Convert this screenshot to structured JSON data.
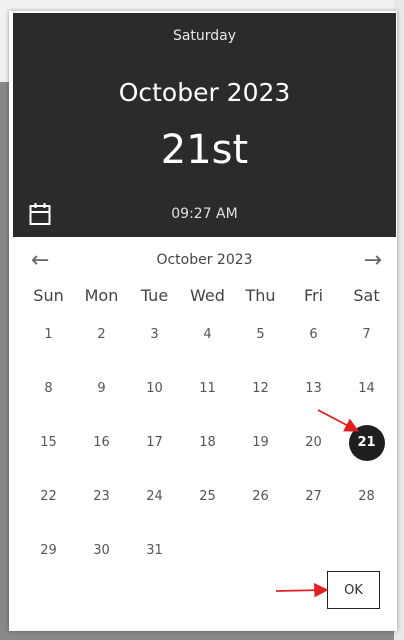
{
  "header": {
    "weekday": "Saturday",
    "month_year": "October 2023",
    "day": "21st",
    "time": "09:27 AM"
  },
  "calendar": {
    "nav_title": "October 2023",
    "prev_icon": "arrow-left-icon",
    "next_icon": "arrow-right-icon",
    "weekdays": [
      "Sun",
      "Mon",
      "Tue",
      "Wed",
      "Thu",
      "Fri",
      "Sat"
    ],
    "weeks": [
      [
        "1",
        "2",
        "3",
        "4",
        "5",
        "6",
        "7"
      ],
      [
        "8",
        "9",
        "10",
        "11",
        "12",
        "13",
        "14"
      ],
      [
        "15",
        "16",
        "17",
        "18",
        "19",
        "20",
        "21"
      ],
      [
        "22",
        "23",
        "24",
        "25",
        "26",
        "27",
        "28"
      ],
      [
        "29",
        "30",
        "31",
        "",
        "",
        "",
        ""
      ]
    ],
    "selected_day": "21"
  },
  "footer": {
    "ok_label": "OK"
  },
  "colors": {
    "header_bg": "#2b2b2b",
    "selected_bg": "#1f1f1f",
    "annotation_arrow": "#e02020"
  }
}
